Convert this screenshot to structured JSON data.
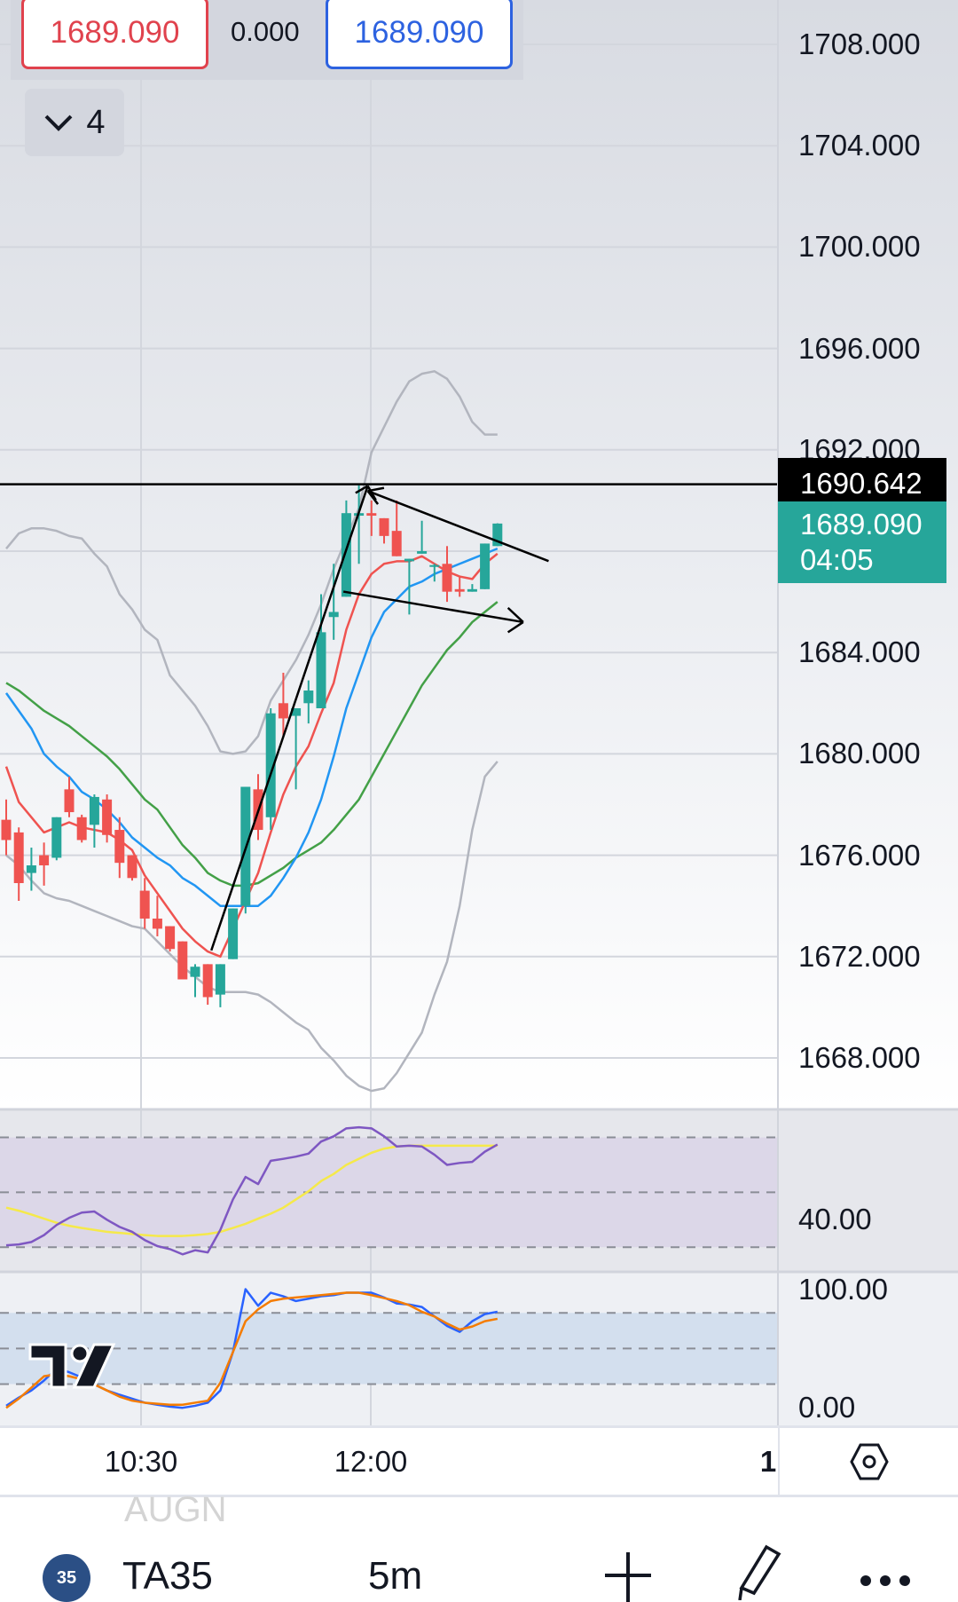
{
  "legend": {
    "value_left": "1689.090",
    "change": "0.000",
    "value_right": "1689.090",
    "collapse_count": "4"
  },
  "price_axis": {
    "labels": [
      "1708.000",
      "1704.000",
      "1700.000",
      "1696.000",
      "1692.000",
      "1684.000",
      "1680.000",
      "1676.000",
      "1672.000",
      "1668.000"
    ]
  },
  "price_labels": {
    "line_price": "1690.642",
    "last_price": "1689.090",
    "countdown": "04:05"
  },
  "rsi_axis": {
    "label": "40.00"
  },
  "stoch_axis": {
    "top": "100.00",
    "bottom": "0.00"
  },
  "time_axis": {
    "labels": [
      "10:30",
      "12:00"
    ],
    "page": "1"
  },
  "ghost_text": "AUGN",
  "bottom_bar": {
    "badge": "35",
    "symbol": "TA35",
    "interval": "5m"
  },
  "colors": {
    "up": "#26a69a",
    "down": "#ef5350",
    "ma_fast": "#ef5350",
    "ma_mid": "#2196f3",
    "ma_slow": "#43a047",
    "bands": "#b2b5be",
    "rsi": "#7e57c2",
    "rsi_ma": "#f5e94a",
    "stoch_k": "#2962ff",
    "stoch_d": "#f57c00"
  },
  "chart_data": {
    "type": "candlestick",
    "ylim": [
      1666,
      1710
    ],
    "candles": [
      [
        1677.4,
        1678.2,
        1676.0,
        1676.6
      ],
      [
        1676.9,
        1677.1,
        1674.2,
        1674.9
      ],
      [
        1675.3,
        1676.3,
        1674.6,
        1675.6
      ],
      [
        1676.0,
        1676.5,
        1674.8,
        1675.6
      ],
      [
        1675.9,
        1677.5,
        1675.8,
        1677.5
      ],
      [
        1678.6,
        1679.1,
        1677.5,
        1677.7
      ],
      [
        1677.5,
        1677.6,
        1676.5,
        1676.6
      ],
      [
        1677.2,
        1678.4,
        1676.3,
        1678.3
      ],
      [
        1678.2,
        1678.4,
        1676.5,
        1676.8
      ],
      [
        1677.0,
        1677.5,
        1675.1,
        1675.7
      ],
      [
        1676.0,
        1676.0,
        1675.0,
        1675.1
      ],
      [
        1674.6,
        1675.1,
        1673.1,
        1673.5
      ],
      [
        1673.5,
        1674.4,
        1672.8,
        1673.1
      ],
      [
        1673.2,
        1673.2,
        1672.2,
        1672.3
      ],
      [
        1672.6,
        1672.6,
        1671.1,
        1671.1
      ],
      [
        1671.2,
        1671.7,
        1670.4,
        1671.6
      ],
      [
        1671.7,
        1671.7,
        1670.1,
        1670.4
      ],
      [
        1670.5,
        1671.7,
        1670.0,
        1671.7
      ],
      [
        1671.9,
        1673.9,
        1671.9,
        1673.9
      ],
      [
        1674.0,
        1678.7,
        1673.7,
        1678.7
      ],
      [
        1678.6,
        1679.2,
        1676.6,
        1677.0
      ],
      [
        1677.5,
        1681.8,
        1677.0,
        1681.6
      ],
      [
        1682.0,
        1683.2,
        1680.7,
        1681.4
      ],
      [
        1681.5,
        1681.8,
        1678.6,
        1681.8
      ],
      [
        1682.0,
        1682.9,
        1681.2,
        1682.5
      ],
      [
        1681.8,
        1686.3,
        1681.8,
        1684.8
      ],
      [
        1685.4,
        1687.5,
        1684.5,
        1685.6
      ],
      [
        1686.2,
        1690.0,
        1686.2,
        1689.5
      ],
      [
        1689.4,
        1690.6,
        1687.5,
        1689.5
      ],
      [
        1689.5,
        1690.0,
        1688.6,
        1689.4
      ],
      [
        1689.3,
        1689.3,
        1688.3,
        1688.6
      ],
      [
        1688.8,
        1690.0,
        1687.8,
        1687.8
      ],
      [
        1687.6,
        1687.7,
        1685.5,
        1687.7
      ],
      [
        1687.9,
        1689.2,
        1687.9,
        1688.0
      ],
      [
        1687.4,
        1687.5,
        1686.8,
        1687.45
      ],
      [
        1687.5,
        1688.2,
        1686.0,
        1686.4
      ],
      [
        1686.5,
        1687.0,
        1686.2,
        1686.4
      ],
      [
        1686.4,
        1686.7,
        1686.4,
        1686.5
      ],
      [
        1686.5,
        1688.3,
        1686.5,
        1688.3
      ],
      [
        1688.2,
        1689.1,
        1688.2,
        1689.09
      ]
    ],
    "ma_fast": [
      1679.5,
      1678.1,
      1677.5,
      1676.9,
      1677.1,
      1677.3,
      1677.1,
      1677.0,
      1676.9,
      1676.6,
      1676.2,
      1675.2,
      1674.5,
      1673.8,
      1673.1,
      1672.6,
      1672.2,
      1672.0,
      1673.1,
      1674.2,
      1675.3,
      1676.9,
      1678.4,
      1679.5,
      1680.3,
      1681.6,
      1682.8,
      1684.9,
      1686.3,
      1687.1,
      1687.5,
      1687.6,
      1687.6,
      1687.8,
      1687.5,
      1687.2,
      1687.0,
      1686.9,
      1687.5,
      1687.9
    ],
    "ma_mid": [
      1682.4,
      1681.7,
      1681.0,
      1680.0,
      1679.5,
      1679.1,
      1678.5,
      1678.2,
      1677.8,
      1677.3,
      1676.7,
      1676.3,
      1675.9,
      1675.6,
      1675.1,
      1674.8,
      1674.4,
      1674.0,
      1674.0,
      1674.0,
      1674.0,
      1674.4,
      1675.1,
      1675.9,
      1676.9,
      1678.2,
      1679.9,
      1681.8,
      1683.2,
      1684.6,
      1685.6,
      1686.1,
      1686.6,
      1686.8,
      1687.1,
      1687.3,
      1687.5,
      1687.7,
      1687.9,
      1688.1
    ],
    "ma_slow": [
      1682.8,
      1682.5,
      1682.1,
      1681.7,
      1681.4,
      1681.1,
      1680.7,
      1680.3,
      1679.9,
      1679.4,
      1678.8,
      1678.2,
      1677.8,
      1677.1,
      1676.4,
      1675.9,
      1675.3,
      1675.0,
      1674.8,
      1674.8,
      1674.9,
      1675.2,
      1675.5,
      1675.9,
      1676.2,
      1676.5,
      1677.0,
      1677.6,
      1678.2,
      1679.1,
      1680.0,
      1680.9,
      1681.8,
      1682.7,
      1683.4,
      1684.1,
      1684.6,
      1685.2,
      1685.6,
      1686.0
    ],
    "band_upper": [
      1688.1,
      1688.7,
      1688.9,
      1688.9,
      1688.8,
      1688.6,
      1688.5,
      1687.9,
      1687.4,
      1686.3,
      1685.7,
      1684.9,
      1684.5,
      1683.1,
      1682.5,
      1681.9,
      1681.1,
      1680.1,
      1680.0,
      1680.1,
      1680.7,
      1682.1,
      1682.9,
      1683.7,
      1684.7,
      1685.9,
      1687.3,
      1688.5,
      1689.7,
      1691.9,
      1692.9,
      1693.9,
      1694.7,
      1695.0,
      1695.1,
      1694.8,
      1694.1,
      1693.1,
      1692.6,
      1692.6
    ],
    "band_lower": [
      1676.0,
      1675.6,
      1675.0,
      1674.5,
      1674.3,
      1674.2,
      1674.0,
      1673.8,
      1673.6,
      1673.4,
      1673.2,
      1673.1,
      1672.6,
      1672.1,
      1671.6,
      1671.2,
      1670.8,
      1670.6,
      1670.6,
      1670.6,
      1670.5,
      1670.2,
      1669.8,
      1669.4,
      1669.1,
      1668.4,
      1667.9,
      1667.3,
      1666.9,
      1666.7,
      1666.8,
      1667.4,
      1668.2,
      1669.0,
      1670.5,
      1671.8,
      1674.0,
      1677.0,
      1679.1,
      1679.7
    ],
    "rsi": [
      30.7,
      31,
      31.9,
      34.4,
      38.1,
      40.7,
      42.6,
      43,
      40,
      37.4,
      35.6,
      32.6,
      30.4,
      29.3,
      27.4,
      28.9,
      28.1,
      36.3,
      47.4,
      55.6,
      53,
      61.5,
      62.2,
      63,
      64.1,
      68.5,
      70.4,
      73.3,
      73.7,
      73.3,
      70.4,
      66.7,
      67,
      66.7,
      63.7,
      60,
      60.7,
      61.1,
      64.8,
      67.4
    ],
    "rsi_ma": [
      44.4,
      43.3,
      41.9,
      40.4,
      38.9,
      37.8,
      37,
      36.3,
      35.6,
      35.2,
      34.8,
      34.4,
      34.1,
      34.1,
      34.1,
      34.4,
      34.8,
      35.6,
      37,
      38.5,
      40.4,
      42.2,
      44.4,
      47.4,
      50.4,
      54.1,
      56.7,
      60,
      62.2,
      64.4,
      65.9,
      66.7,
      67,
      67,
      67,
      67,
      67,
      67,
      67,
      67
    ],
    "rsi_levels": [
      70,
      50,
      30
    ],
    "stoch_k": [
      1.7,
      8.6,
      14.6,
      23,
      33,
      30,
      25.7,
      19.7,
      14.6,
      11,
      7.7,
      4.3,
      2.6,
      1,
      0,
      1.7,
      4.3,
      14.6,
      47,
      100,
      86,
      97,
      94,
      90,
      92,
      94,
      95,
      97,
      97,
      97,
      93,
      88,
      87,
      85,
      77,
      69,
      64,
      73,
      79,
      81
    ],
    "stoch_d": [
      0,
      7.7,
      17,
      26.6,
      28.3,
      26.6,
      24,
      19.7,
      14.6,
      9.4,
      6,
      4.3,
      3.4,
      2.6,
      2.6,
      4.3,
      6,
      21,
      47,
      73,
      83,
      90,
      92,
      93,
      94,
      95,
      96,
      97,
      97,
      95,
      92.5,
      90,
      86.5,
      81,
      77,
      71,
      66,
      68.5,
      73,
      75
    ],
    "stoch_levels": [
      80,
      50,
      20
    ],
    "horizontal_line": 1690.642,
    "last_price": 1689.09
  }
}
